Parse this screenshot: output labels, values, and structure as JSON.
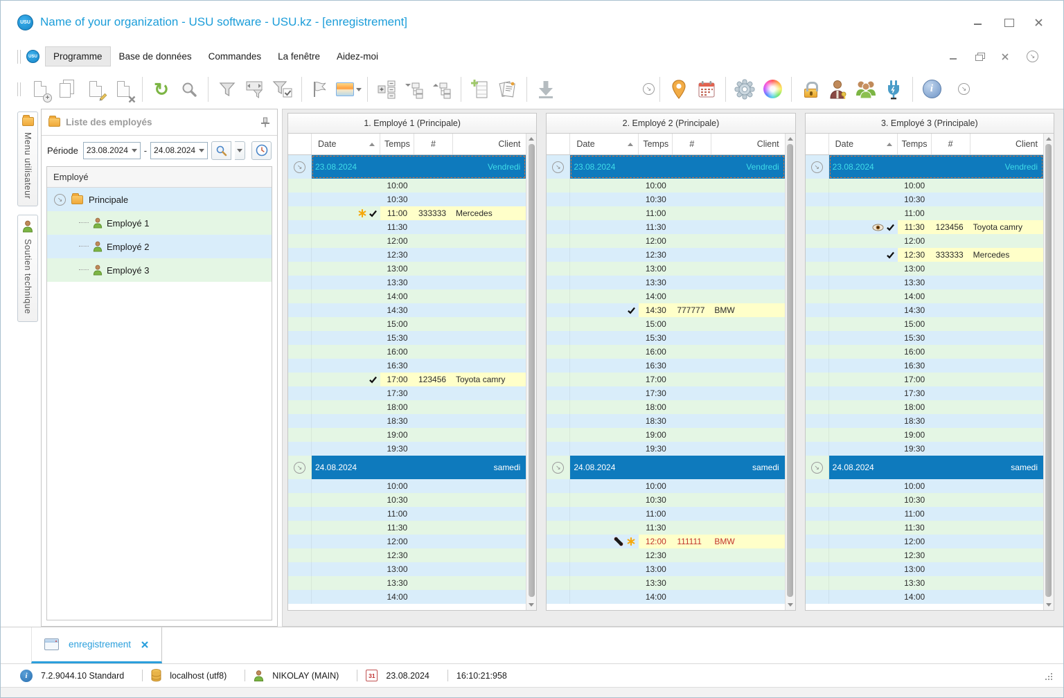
{
  "window": {
    "title": "Name of your organization - USU software - USU.kz - [enregistrement]",
    "logo_text": "USU"
  },
  "menu": {
    "items": [
      "Programme",
      "Base de données",
      "Commandes",
      "La fenêtre",
      "Aidez-moi"
    ],
    "active": "Programme"
  },
  "toolbar_icons": [
    "new-document",
    "copy-document",
    "edit-document",
    "delete-document",
    "refresh",
    "search",
    "filter",
    "filter-columns",
    "filter-check",
    "flag",
    "image-picker",
    "expand-nodes",
    "collapse-tree",
    "expand-tree",
    "add-row",
    "reports",
    "download",
    "chevron-more",
    "location-pin",
    "calendar",
    "settings-gear",
    "color-wheel",
    "lock",
    "user-key",
    "users-group",
    "plug",
    "info",
    "chevron-more"
  ],
  "sidebar": {
    "tab_user_menu": "Menu utilisateur",
    "tab_support": "Soutien technique",
    "panel_title": "Liste des employés",
    "period_label": "Période",
    "period_from": "23.08.2024",
    "period_to": "24.08.2024",
    "period_dash": "-",
    "tree_header": "Employé",
    "tree_root": "Principale",
    "employees": [
      "Employé 1",
      "Employé 2",
      "Employé 3"
    ]
  },
  "schedule": {
    "columns": {
      "date": "Date",
      "time": "Temps",
      "num": "#",
      "client": "Client"
    },
    "day1_times": [
      "10:00",
      "10:30",
      "11:00",
      "11:30",
      "12:00",
      "12:30",
      "13:00",
      "13:30",
      "14:00",
      "14:30",
      "15:00",
      "15:30",
      "16:00",
      "16:30",
      "17:00",
      "17:30",
      "18:00",
      "18:30",
      "19:00",
      "19:30"
    ],
    "day2_times": [
      "10:00",
      "10:30",
      "11:00",
      "11:30",
      "12:00",
      "12:30",
      "13:00",
      "13:30",
      "14:00"
    ],
    "panels": [
      {
        "title": "1. Employé 1 (Principale)",
        "groups": [
          {
            "date": "23.08.2024",
            "day": "Vendredi",
            "focused": true,
            "appointments": [
              {
                "time": "11:00",
                "num": "333333",
                "client": "Mercedes",
                "icons": [
                  "asterisk",
                  "check"
                ],
                "red": false
              },
              {
                "time": "17:00",
                "num": "123456",
                "client": "Toyota camry",
                "icons": [
                  "check"
                ],
                "red": false
              }
            ]
          },
          {
            "date": "24.08.2024",
            "day": "samedi",
            "focused": false,
            "appointments": []
          }
        ]
      },
      {
        "title": "2. Employé 2 (Principale)",
        "groups": [
          {
            "date": "23.08.2024",
            "day": "Vendredi",
            "focused": true,
            "appointments": [
              {
                "time": "14:30",
                "num": "777777",
                "client": "BMW",
                "icons": [
                  "check"
                ],
                "red": false
              }
            ]
          },
          {
            "date": "24.08.2024",
            "day": "samedi",
            "focused": false,
            "appointments": [
              {
                "time": "12:00",
                "num": "111111",
                "client": "BMW",
                "icons": [
                  "phone",
                  "asterisk"
                ],
                "red": true
              }
            ]
          }
        ]
      },
      {
        "title": "3. Employé 3 (Principale)",
        "groups": [
          {
            "date": "23.08.2024",
            "day": "Vendredi",
            "focused": true,
            "appointments": [
              {
                "time": "11:30",
                "num": "123456",
                "client": "Toyota camry",
                "icons": [
                  "eye",
                  "check"
                ],
                "red": false
              },
              {
                "time": "12:30",
                "num": "333333",
                "client": "Mercedes",
                "icons": [
                  "check"
                ],
                "red": false
              }
            ]
          },
          {
            "date": "24.08.2024",
            "day": "samedi",
            "focused": false,
            "appointments": []
          }
        ]
      }
    ]
  },
  "footer_tab": {
    "label": "enregistrement"
  },
  "statusbar": {
    "version": "7.2.9044.10 Standard",
    "database": "localhost (utf8)",
    "user": "NIKOLAY (MAIN)",
    "calendar_day": "31",
    "date": "23.08.2024",
    "time": "16:10:21:958"
  },
  "colors": {
    "accent_blue": "#1b9dd9",
    "group_header_blue": "#0e7abd",
    "focused_date_text": "#3fdbe8",
    "row_green": "#e4f6e4",
    "row_blue": "#d9edfa",
    "appointment_yellow": "#ffffc9",
    "alert_red": "#c2332b"
  }
}
